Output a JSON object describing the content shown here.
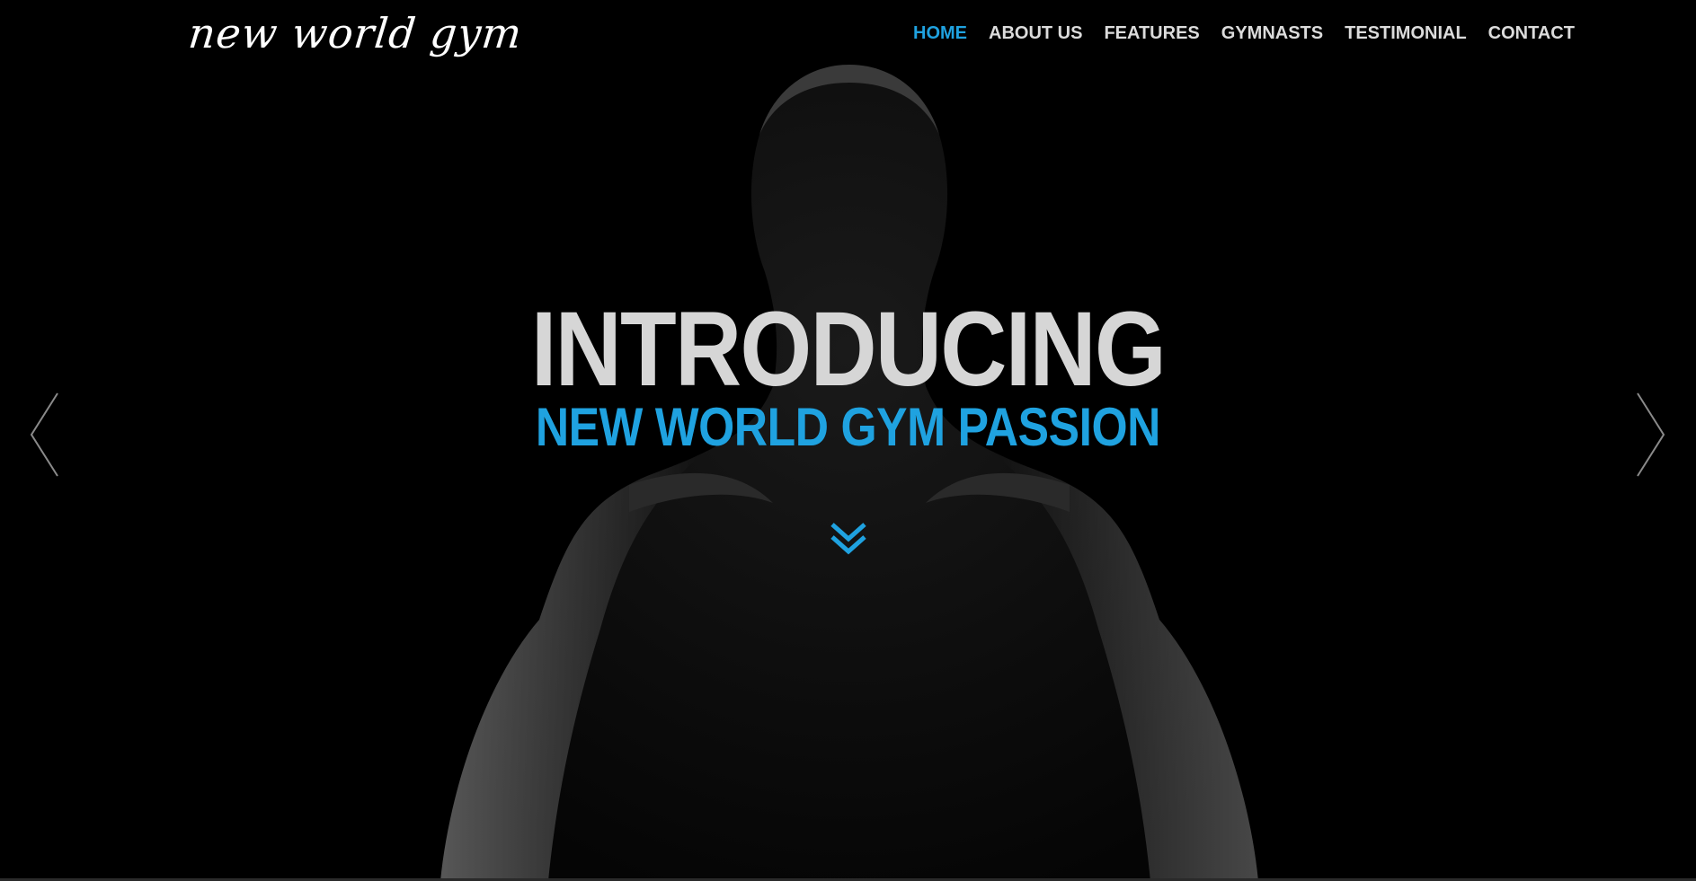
{
  "brand": {
    "logo_text": "new world gym"
  },
  "nav": {
    "items": [
      {
        "label": "HOME",
        "active": true
      },
      {
        "label": "ABOUT US",
        "active": false
      },
      {
        "label": "FEATURES",
        "active": false
      },
      {
        "label": "GYMNASTS",
        "active": false
      },
      {
        "label": "TESTIMONIAL",
        "active": false
      },
      {
        "label": "CONTACT",
        "active": false
      }
    ]
  },
  "hero": {
    "headline": "INTRODUCING",
    "subheadline": "NEW WORLD GYM PASSION",
    "scroll_icon": "double-chevron-down-icon",
    "prev_icon": "chevron-left-icon",
    "next_icon": "chevron-right-icon"
  },
  "colors": {
    "accent": "#1fa2e0",
    "headline": "#d6d6d6",
    "nav_text": "#dcdcdc",
    "background": "#000000"
  }
}
